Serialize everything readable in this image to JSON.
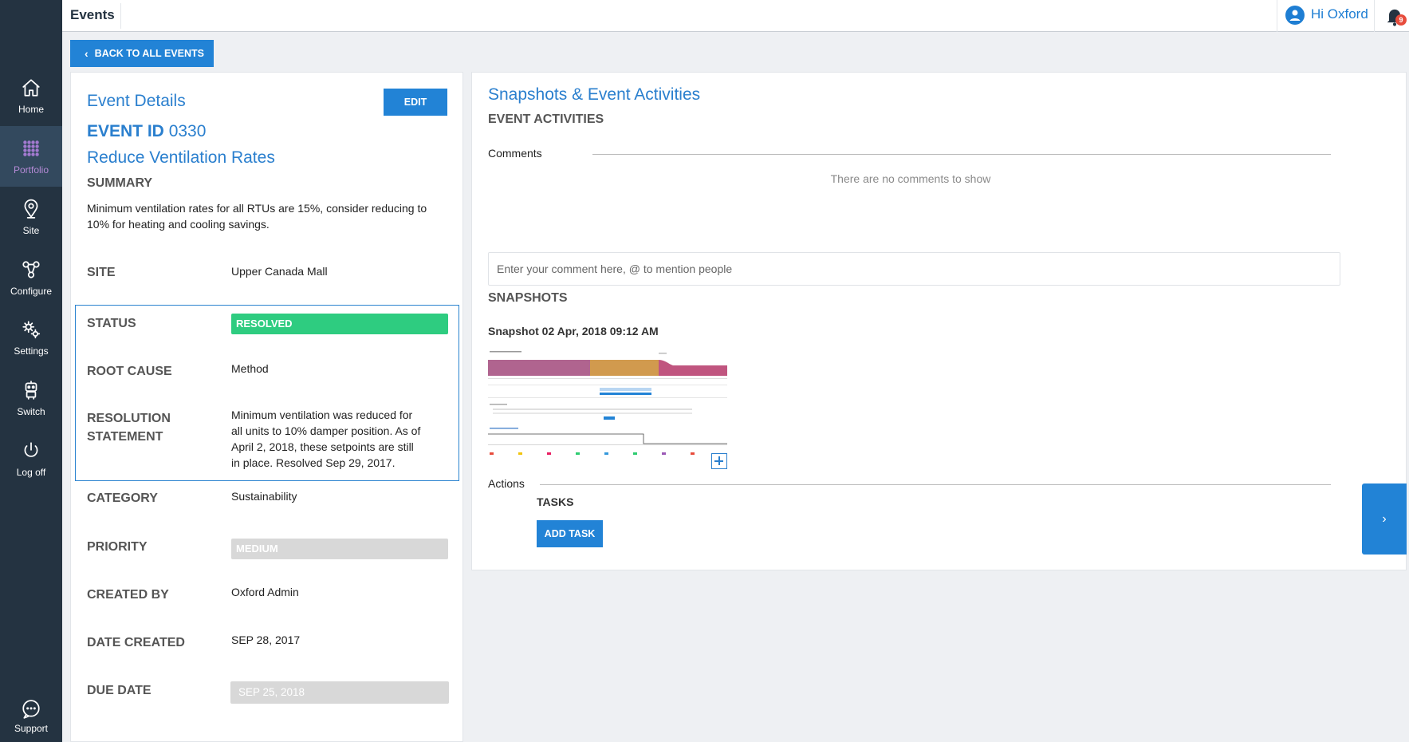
{
  "sidebar": {
    "items": [
      {
        "label": "Home",
        "icon": "home-icon"
      },
      {
        "label": "Portfolio",
        "icon": "grid-dots-icon",
        "active": true
      },
      {
        "label": "Site",
        "icon": "map-pin-icon"
      },
      {
        "label": "Configure",
        "icon": "network-icon"
      },
      {
        "label": "Settings",
        "icon": "gears-icon"
      },
      {
        "label": "Switch",
        "icon": "robot-icon"
      },
      {
        "label": "Log off",
        "icon": "power-icon"
      }
    ],
    "support_label": "Support"
  },
  "header": {
    "title": "Events",
    "greeting": "Hi Oxford",
    "notification_count": "9"
  },
  "back_button": "BACK TO ALL EVENTS",
  "event_details": {
    "heading": "Event Details",
    "edit_label": "EDIT",
    "event_id_label": "EVENT ID",
    "event_id": "0330",
    "event_name": "Reduce Ventilation Rates",
    "summary_heading": "SUMMARY",
    "summary_text": "Minimum ventilation rates for all RTUs are 15%, consider reducing to 10% for heating and cooling savings.",
    "fields": {
      "site": {
        "label": "SITE",
        "value": "Upper Canada Mall"
      },
      "status": {
        "label": "STATUS",
        "value": "RESOLVED"
      },
      "root_cause": {
        "label": "ROOT CAUSE",
        "value": "Method"
      },
      "resolution": {
        "label": "RESOLUTION STATEMENT",
        "value": "Minimum ventilation was reduced for all units to 10% damper position. As of April 2, 2018, these setpoints are still in place. Resolved Sep 29, 2017."
      },
      "category": {
        "label": "CATEGORY",
        "value": "Sustainability"
      },
      "priority": {
        "label": "PRIORITY",
        "value": "MEDIUM"
      },
      "created_by": {
        "label": "CREATED BY",
        "value": "Oxford Admin"
      },
      "date_created": {
        "label": "DATE CREATED",
        "value": "SEP 28, 2017"
      },
      "due_date": {
        "label": "DUE DATE",
        "value": "SEP 25, 2018"
      }
    }
  },
  "activities": {
    "heading": "Snapshots & Event Activities",
    "event_activities_heading": "EVENT ACTIVITIES",
    "comments_label": "Comments",
    "no_comments": "There are no comments to show",
    "comment_placeholder": "Enter your comment here, @ to mention people",
    "snapshots_heading": "SNAPSHOTS",
    "snapshot_title": "Snapshot 02 Apr, 2018 09:12 AM",
    "actions_label": "Actions",
    "tasks_heading": "TASKS",
    "add_task_label": "ADD TASK"
  },
  "colors": {
    "sidebar_bg": "#243341",
    "accent": "#2283d6",
    "status_resolved": "#2ecc80",
    "active_nav": "#b58ad6"
  }
}
